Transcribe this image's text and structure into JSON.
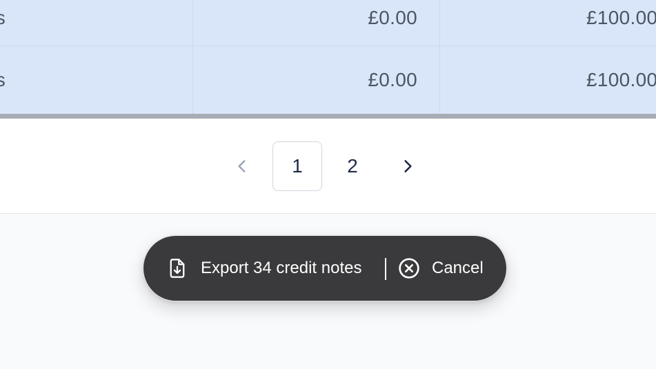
{
  "table": {
    "rows": [
      {
        "lead": "s",
        "amount_1": "£0.00",
        "amount_2": "£100.00"
      },
      {
        "lead": "s",
        "amount_1": "£0.00",
        "amount_2": "£100.00"
      }
    ]
  },
  "pagination": {
    "prev_icon": "chevron-left-icon",
    "next_icon": "chevron-right-icon",
    "pages": [
      "1",
      "2"
    ],
    "current_page": "1"
  },
  "bulk_action_bar": {
    "export_icon": "file-download-icon",
    "export_label": "Export 34 credit notes",
    "cancel_icon": "circle-x-icon",
    "cancel_label": "Cancel"
  },
  "colors": {
    "selected_row_bg": "#d9e6f9",
    "pill_bg": "#3a3a3c",
    "page_bg": "#f9fafb"
  }
}
